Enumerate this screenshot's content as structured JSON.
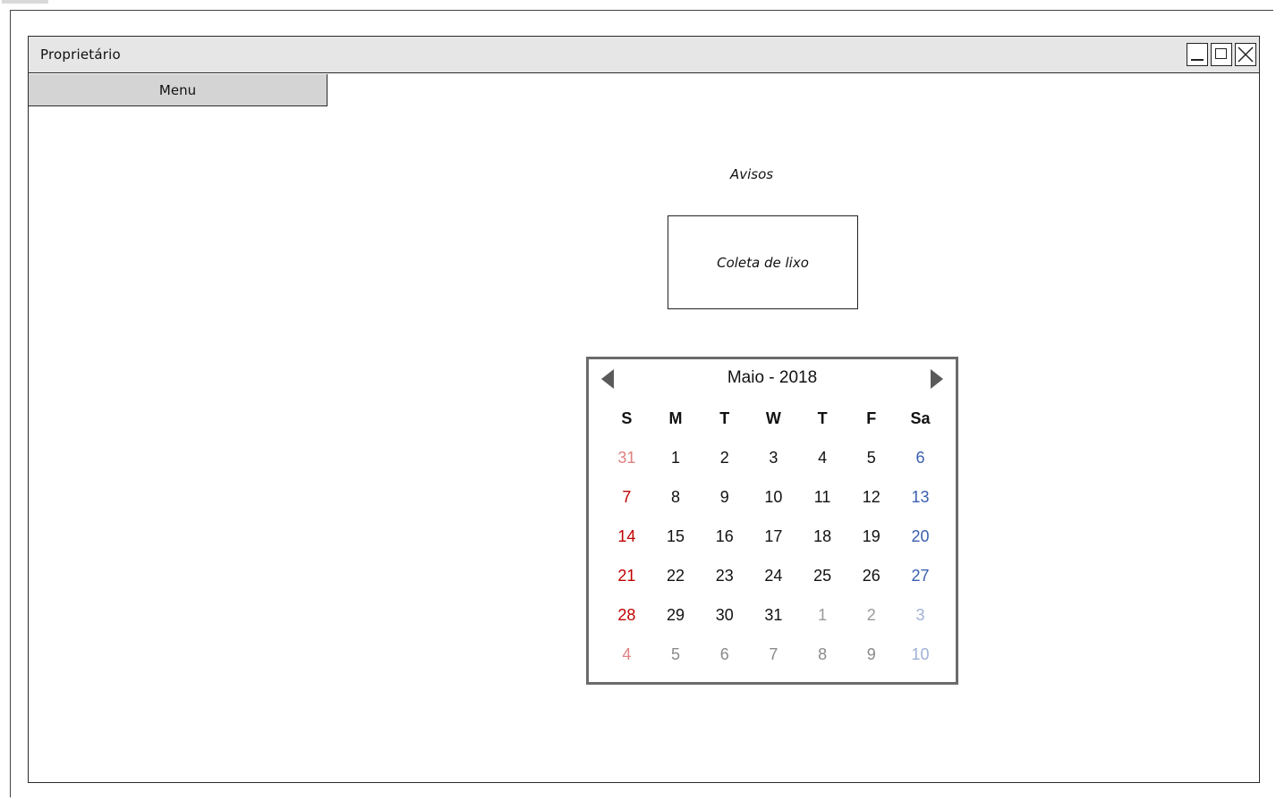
{
  "window": {
    "title": "Proprietário"
  },
  "menu": {
    "label": "Menu"
  },
  "notices": {
    "heading": "Avisos",
    "items": [
      {
        "label": "Coleta de lixo"
      }
    ]
  },
  "calendar": {
    "title": "Maio - 2018",
    "weekdays": [
      "S",
      "M",
      "T",
      "W",
      "T",
      "F",
      "Sa"
    ],
    "weeks": [
      [
        {
          "d": "31",
          "c": "#e08080"
        },
        {
          "d": "1",
          "c": "#111111"
        },
        {
          "d": "2",
          "c": "#111111"
        },
        {
          "d": "3",
          "c": "#111111"
        },
        {
          "d": "4",
          "c": "#111111"
        },
        {
          "d": "5",
          "c": "#111111"
        },
        {
          "d": "6",
          "c": "#3a5fb0"
        }
      ],
      [
        {
          "d": "7",
          "c": "#c00000"
        },
        {
          "d": "8",
          "c": "#111111"
        },
        {
          "d": "9",
          "c": "#111111"
        },
        {
          "d": "10",
          "c": "#111111"
        },
        {
          "d": "11",
          "c": "#111111"
        },
        {
          "d": "12",
          "c": "#111111"
        },
        {
          "d": "13",
          "c": "#3a5fb0"
        }
      ],
      [
        {
          "d": "14",
          "c": "#c00000"
        },
        {
          "d": "15",
          "c": "#111111"
        },
        {
          "d": "16",
          "c": "#111111"
        },
        {
          "d": "17",
          "c": "#111111"
        },
        {
          "d": "18",
          "c": "#111111"
        },
        {
          "d": "19",
          "c": "#111111"
        },
        {
          "d": "20",
          "c": "#3a5fb0"
        }
      ],
      [
        {
          "d": "21",
          "c": "#c00000"
        },
        {
          "d": "22",
          "c": "#111111"
        },
        {
          "d": "23",
          "c": "#111111"
        },
        {
          "d": "24",
          "c": "#111111"
        },
        {
          "d": "25",
          "c": "#111111"
        },
        {
          "d": "26",
          "c": "#111111"
        },
        {
          "d": "27",
          "c": "#3a5fb0"
        }
      ],
      [
        {
          "d": "28",
          "c": "#c00000"
        },
        {
          "d": "29",
          "c": "#111111"
        },
        {
          "d": "30",
          "c": "#111111"
        },
        {
          "d": "31",
          "c": "#111111"
        },
        {
          "d": "1",
          "c": "#9a9a9a"
        },
        {
          "d": "2",
          "c": "#9a9a9a"
        },
        {
          "d": "3",
          "c": "#9fb0d6"
        }
      ],
      [
        {
          "d": "4",
          "c": "#e08080"
        },
        {
          "d": "5",
          "c": "#8a8a8a"
        },
        {
          "d": "6",
          "c": "#8a8a8a"
        },
        {
          "d": "7",
          "c": "#8a8a8a"
        },
        {
          "d": "8",
          "c": "#8a8a8a"
        },
        {
          "d": "9",
          "c": "#8a8a8a"
        },
        {
          "d": "10",
          "c": "#9fb0d6"
        }
      ]
    ]
  },
  "icons": {
    "prev": "triangle-left-icon",
    "next": "triangle-right-icon",
    "minimize": "minimize-icon",
    "maximize": "maximize-icon",
    "close": "close-icon"
  }
}
